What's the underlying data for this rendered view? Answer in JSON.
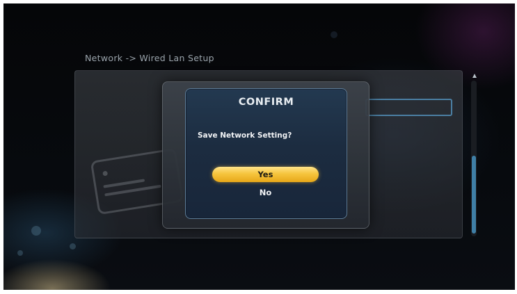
{
  "breadcrumb": "Network -> Wired Lan Setup",
  "dialog": {
    "title": "CONFIRM",
    "message": "Save Network Setting?",
    "buttons": {
      "yes": "Yes",
      "no": "No"
    },
    "selected_button": "yes"
  },
  "colors": {
    "selected_button": "#f6c53e",
    "dialog_background": "#1c2c40",
    "scrollbar_thumb": "#3f7fa6",
    "field_border": "#4b7fa3"
  },
  "icons": {
    "background_card": "network-card-icon"
  }
}
